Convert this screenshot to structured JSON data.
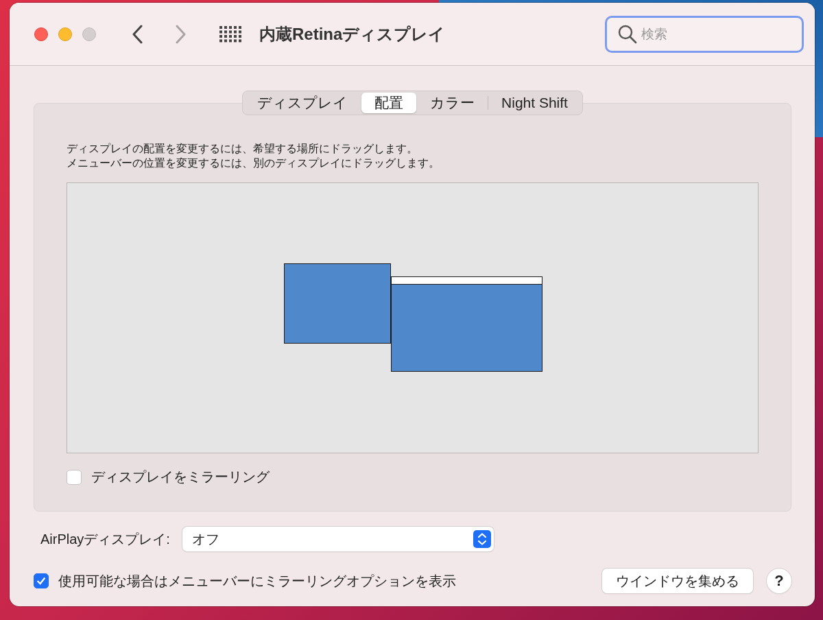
{
  "window": {
    "title": "内蔵Retinaディスプレイ",
    "back_enabled": true,
    "forward_enabled": false
  },
  "search": {
    "placeholder": "検索"
  },
  "tabs": [
    {
      "label": "ディスプレイ",
      "selected": false
    },
    {
      "label": "配置",
      "selected": true
    },
    {
      "label": "カラー",
      "selected": false
    },
    {
      "label": "Night Shift",
      "selected": false
    }
  ],
  "instructions": [
    "ディスプレイの配置を変更するには、希望する場所にドラッグします。",
    "メニューバーの位置を変更するには、別のディスプレイにドラッグします。"
  ],
  "displays": [
    {
      "menu_bar": false
    },
    {
      "menu_bar": true
    }
  ],
  "mirror": {
    "label": "ディスプレイをミラーリング",
    "checked": false
  },
  "airplay": {
    "label": "AirPlayディスプレイ:",
    "value": "オフ"
  },
  "show_options": {
    "label": "使用可能な場合はメニューバーにミラーリングオプションを表示",
    "checked": true
  },
  "buttons": [
    {
      "kind": "text",
      "label": "ウインドウを集める"
    },
    {
      "kind": "help",
      "label": "?"
    }
  ]
}
